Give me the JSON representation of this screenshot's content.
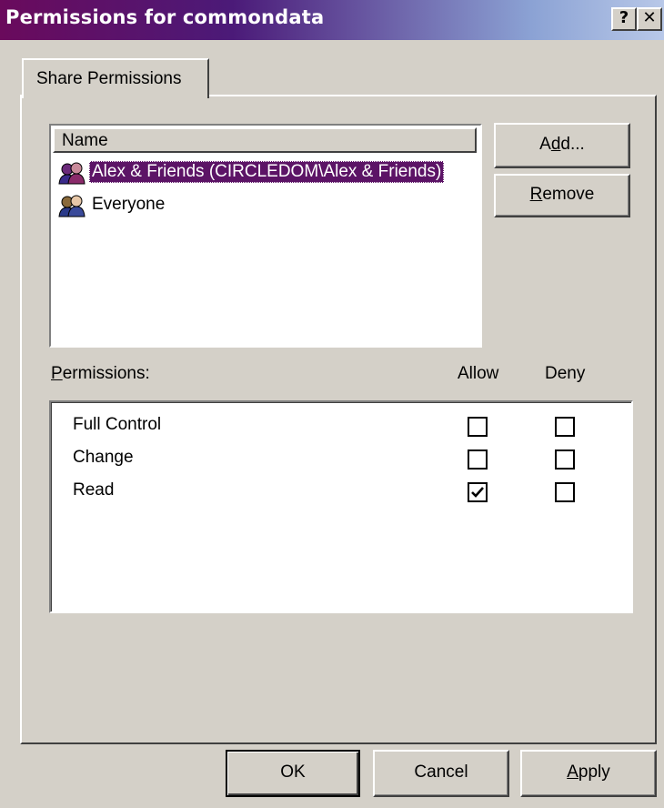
{
  "window": {
    "title": "Permissions for commondata",
    "help_glyph": "?",
    "close_glyph": "✕"
  },
  "tabs": [
    {
      "label": "Share Permissions",
      "active": true
    }
  ],
  "names_list": {
    "header": "Name",
    "items": [
      {
        "label": "Alex & Friends (CIRCLEDOM\\Alex & Friends)",
        "icon": "user-group-icon",
        "selected": true
      },
      {
        "label": "Everyone",
        "icon": "user-group-icon",
        "selected": false
      }
    ]
  },
  "buttons": {
    "add": {
      "label": "Add...",
      "underline": "d"
    },
    "remove": {
      "label": "Remove",
      "underline": "R"
    },
    "ok": {
      "label": "OK"
    },
    "cancel": {
      "label": "Cancel"
    },
    "apply": {
      "label": "Apply",
      "underline": "A"
    }
  },
  "permissions": {
    "label": "Permissions:",
    "allow_header": "Allow",
    "deny_header": "Deny",
    "rows": [
      {
        "name": "Full Control",
        "allow": false,
        "deny": false
      },
      {
        "name": "Change",
        "allow": false,
        "deny": false
      },
      {
        "name": "Read",
        "allow": true,
        "deny": false
      }
    ]
  },
  "colors": {
    "selection": "#5c1466",
    "titlebar_start": "#6a0a5c",
    "titlebar_end": "#b8c8e8",
    "dialog_bg": "#d4d0c8"
  }
}
